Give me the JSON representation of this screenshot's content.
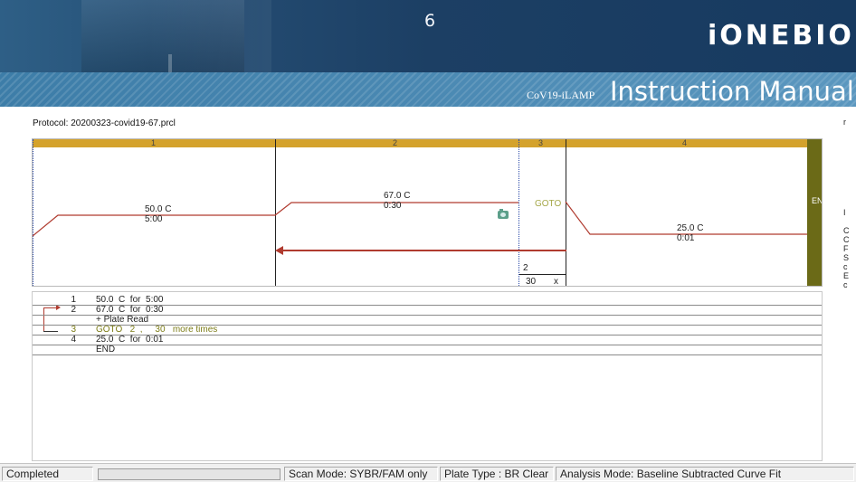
{
  "header": {
    "page_number": "6",
    "logo_text": "iONEBIO",
    "subtitle_small": "CoV19-iLAMP",
    "subtitle_big": "Instruction Manual",
    "colors": {
      "banner_dark": "#1c3f64",
      "banner_stripe": "#4786b0"
    }
  },
  "window": {
    "protocol_label": "Protocol: 20200323-covid19-67.prcl",
    "right_edge_text": "r\n\n\n\n\n\n\n\n\n\nI\n\nC\nC\nF\nS\nc\nE\nc"
  },
  "graph": {
    "steps": [
      {
        "num": "1",
        "temp": "50.0  C",
        "time": "5:00"
      },
      {
        "num": "2",
        "temp": "67.0  C",
        "time": "0:30"
      },
      {
        "num": "3",
        "goto": "GOTO"
      },
      {
        "num": "4",
        "temp": "25.0  C",
        "time": "0:01"
      }
    ],
    "end_label": "END",
    "goto_target": "2",
    "goto_count": "30",
    "goto_x": "x",
    "colors": {
      "step_bar": "#d4a22c",
      "end_column": "#6b6a17",
      "temp_line": "#b03b2f",
      "goto_text": "#a6a84a"
    }
  },
  "protocol_list": [
    {
      "num": "1",
      "text": "50.0  C  for  5:00",
      "type": "step"
    },
    {
      "num": "2",
      "text": "67.0  C  for  0:30",
      "type": "step"
    },
    {
      "num": "",
      "text": "+ Plate Read",
      "type": "sub"
    },
    {
      "num": "3",
      "text": "GOTO   2  ,     30   more times",
      "type": "goto"
    },
    {
      "num": "4",
      "text": "25.0  C  for  0:01",
      "type": "step"
    },
    {
      "num": "",
      "text": "END",
      "type": "end"
    }
  ],
  "status_bar": {
    "status": "Completed",
    "progress": 0,
    "scan_mode": "Scan Mode: SYBR/FAM only",
    "plate_type": "Plate Type : BR Clear",
    "analysis_mode": "Analysis Mode: Baseline Subtracted Curve Fit"
  }
}
